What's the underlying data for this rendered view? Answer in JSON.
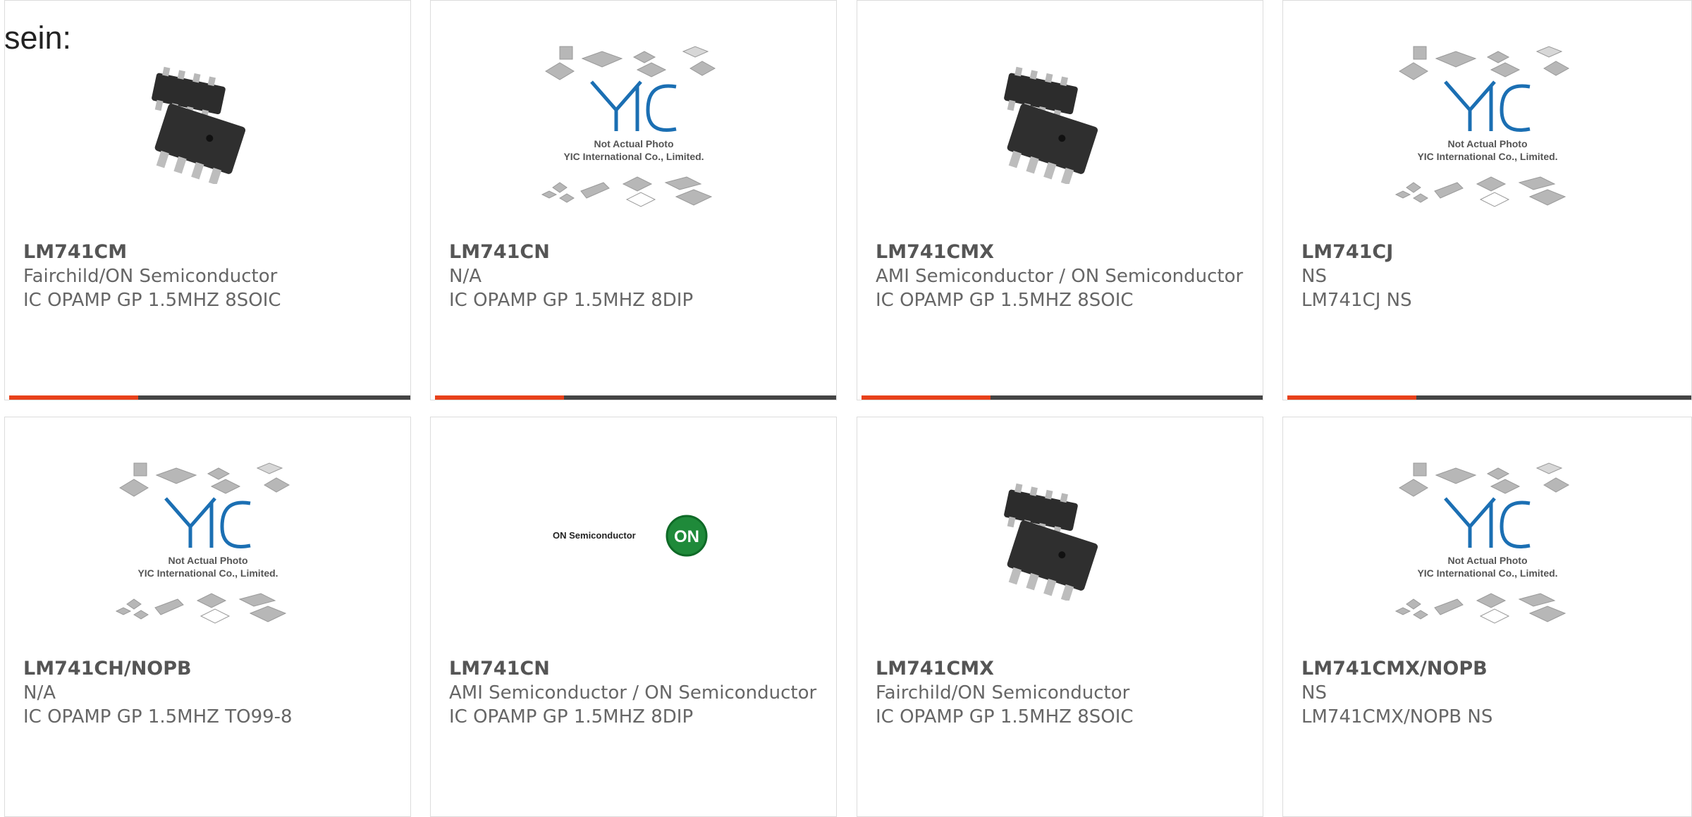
{
  "lead_text": "sein:",
  "photo_caption": {
    "line1": "Not Actual Photo",
    "line2": "YIC International Co., Limited.",
    "logo": "YIC"
  },
  "on_logo": {
    "text": "ON Semiconductor",
    "mark": "ON"
  },
  "colors": {
    "accent": "#e8411a",
    "bar": "#454545",
    "chip": "#2c2c2c",
    "on_green": "#1f8a3a"
  },
  "products": [
    {
      "part": "LM741CM",
      "maker": "Fairchild/ON Semiconductor",
      "desc": "IC OPAMP GP 1.5MHZ 8SOIC",
      "image": "soic-chip"
    },
    {
      "part": "LM741CN",
      "maker": "N/A",
      "desc": "IC OPAMP GP 1.5MHZ 8DIP",
      "image": "yic-placeholder"
    },
    {
      "part": "LM741CMX",
      "maker": "AMI Semiconductor / ON Semiconductor",
      "desc": "IC OPAMP GP 1.5MHZ 8SOIC",
      "image": "soic-chip"
    },
    {
      "part": "LM741CJ",
      "maker": "NS",
      "desc": "LM741CJ NS",
      "image": "yic-placeholder"
    },
    {
      "part": "LM741CH/NOPB",
      "maker": "N/A",
      "desc": "IC OPAMP GP 1.5MHZ TO99-8",
      "image": "yic-placeholder"
    },
    {
      "part": "LM741CN",
      "maker": "AMI Semiconductor / ON Semiconductor",
      "desc": "IC OPAMP GP 1.5MHZ 8DIP",
      "image": "on-semi-logo"
    },
    {
      "part": "LM741CMX",
      "maker": "Fairchild/ON Semiconductor",
      "desc": "IC OPAMP GP 1.5MHZ 8SOIC",
      "image": "soic-chip"
    },
    {
      "part": "LM741CMX/NOPB",
      "maker": "NS",
      "desc": "LM741CMX/NOPB NS",
      "image": "yic-placeholder"
    }
  ]
}
